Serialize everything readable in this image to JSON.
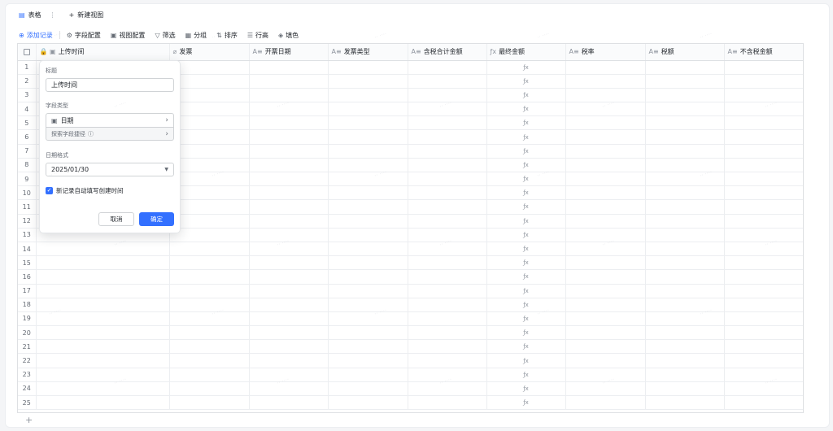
{
  "tabs": {
    "table_label": "表格",
    "more": "⋮",
    "new_view_label": "新建视图"
  },
  "toolbar": [
    {
      "name": "add-record-button",
      "icon": "plus-circle-icon",
      "label": "添加记录"
    },
    {
      "name": "field-config-button",
      "icon": "gear-icon",
      "label": "字段配置"
    },
    {
      "name": "view-config-button",
      "icon": "view-icon",
      "label": "视图配置"
    },
    {
      "name": "filter-button",
      "icon": "filter-icon",
      "label": "筛选"
    },
    {
      "name": "group-button",
      "icon": "group-icon",
      "label": "分组"
    },
    {
      "name": "sort-button",
      "icon": "sort-icon",
      "label": "排序"
    },
    {
      "name": "row-height-button",
      "icon": "row-height-icon",
      "label": "行高"
    },
    {
      "name": "fill-color-button",
      "icon": "fill-icon",
      "label": "填色"
    }
  ],
  "columns": [
    {
      "label": "上传时间",
      "icon": "🔒 ▣"
    },
    {
      "label": "发票",
      "icon": "⌀"
    },
    {
      "label": "开票日期",
      "icon": "A≡"
    },
    {
      "label": "发票类型",
      "icon": "A≡"
    },
    {
      "label": "含税合计金额",
      "icon": "A≡"
    },
    {
      "label": "最终金额",
      "icon": "ƒx"
    },
    {
      "label": "税率",
      "icon": "A≡"
    },
    {
      "label": "税额",
      "icon": "A≡"
    },
    {
      "label": "不含税金额",
      "icon": "A≡"
    }
  ],
  "add_column": "+",
  "row_numbers": [
    "1",
    "2",
    "3",
    "4",
    "5",
    "6",
    "7",
    "8",
    "9",
    "10",
    "11",
    "12",
    "13",
    "14",
    "15",
    "16",
    "17",
    "18",
    "19",
    "20",
    "21",
    "22",
    "23",
    "24",
    "25"
  ],
  "formula_cell_glyph": "ƒx",
  "add_row": "+",
  "popup": {
    "title_label": "标题",
    "title_value": "上传时间",
    "field_type_label": "字段类型",
    "field_type_value": "日期",
    "explore_label": "探索字段捷径",
    "date_format_label": "日期格式",
    "date_format_value": "2025/01/30",
    "auto_fill_label": "新记录自动填写创建时间",
    "auto_fill_checked": true,
    "cancel_label": "取消",
    "confirm_label": "确定"
  },
  "colors": {
    "accent": "#3370ff",
    "border": "#dee0e3",
    "text": "#1f2329"
  }
}
